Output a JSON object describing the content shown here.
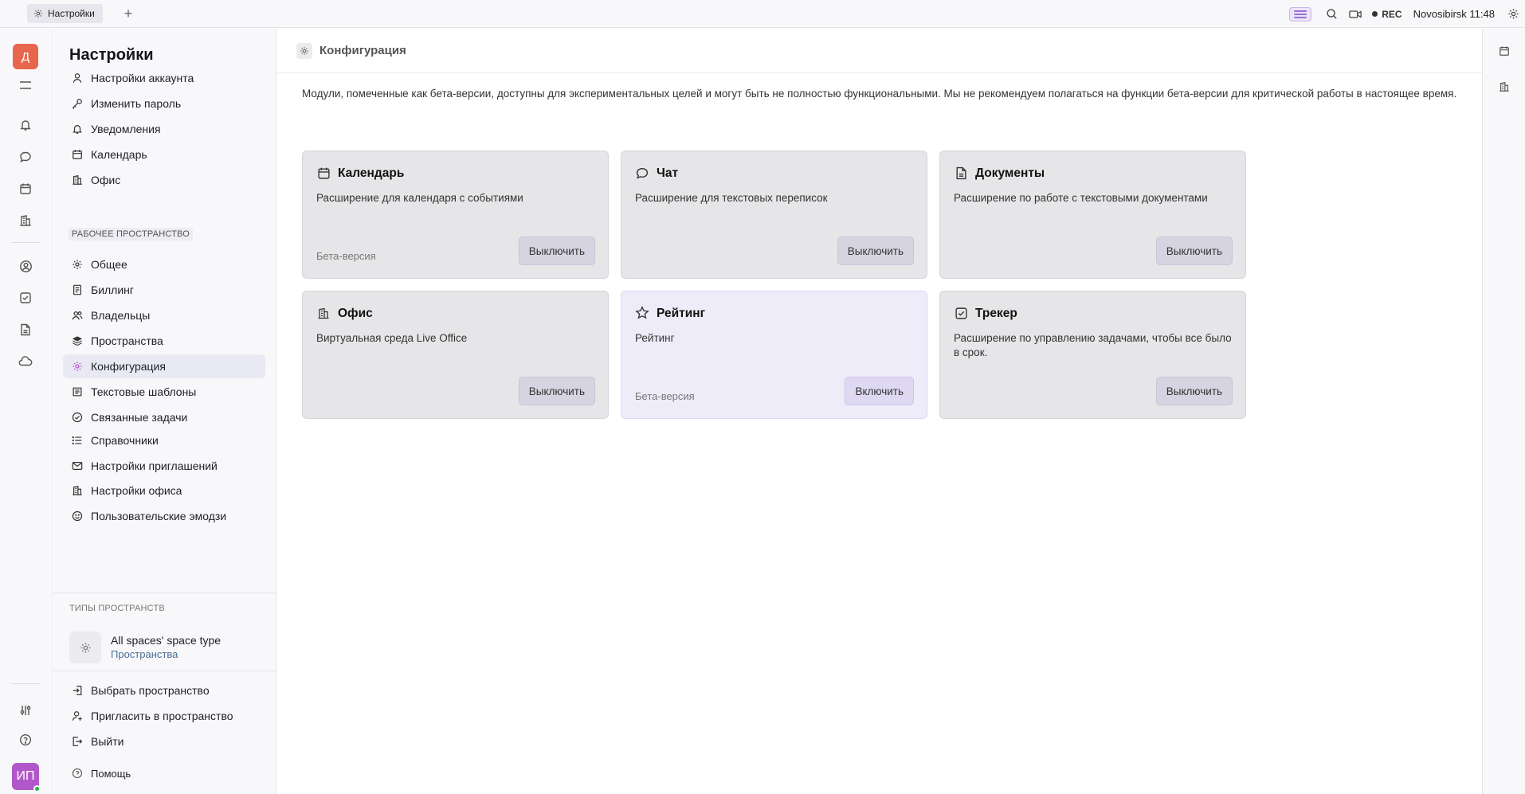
{
  "topbar": {
    "tab_label": "Настройки",
    "tab_icon": "gear-icon",
    "rec_label": "REC",
    "location": "Novosibirsk",
    "time": "11:48"
  },
  "rail": {
    "workspace_initial": "Д",
    "user_initials": "ИП"
  },
  "nav": {
    "title": "Настройки",
    "account_items": [
      {
        "label": "Настройки аккаунта",
        "icon": "user-icon"
      },
      {
        "label": "Изменить пароль",
        "icon": "key-icon"
      },
      {
        "label": "Уведомления",
        "icon": "bell-icon"
      },
      {
        "label": "Календарь",
        "icon": "calendar-icon"
      },
      {
        "label": "Офис",
        "icon": "building-icon"
      }
    ],
    "workspace_section": "РАБОЧЕЕ ПРОСТРАНСТВО",
    "workspace_items": [
      {
        "label": "Общее",
        "icon": "gear-icon"
      },
      {
        "label": "Биллинг",
        "icon": "receipt-icon"
      },
      {
        "label": "Владельцы",
        "icon": "people-icon"
      },
      {
        "label": "Пространства",
        "icon": "layers-icon"
      },
      {
        "label": "Конфигурация",
        "icon": "gear-icon",
        "active": true
      },
      {
        "label": "Текстовые шаблоны",
        "icon": "template-icon"
      },
      {
        "label": "Связанные задачи",
        "icon": "check-circle-icon"
      },
      {
        "label": "Справочники",
        "icon": "list-icon"
      },
      {
        "label": "Настройки приглашений",
        "icon": "mail-icon"
      },
      {
        "label": "Настройки офиса",
        "icon": "building-icon"
      },
      {
        "label": "Пользовательские эмодзи",
        "icon": "emoji-icon"
      }
    ],
    "space_types_section": "ТИПЫ ПРОСТРАНСТВ",
    "space_type": {
      "name": "All spaces' space type",
      "sub": "Пространства"
    },
    "bottom_items": [
      {
        "label": "Выбрать пространство",
        "icon": "enter-icon"
      },
      {
        "label": "Пригласить в пространство",
        "icon": "user-plus-icon"
      },
      {
        "label": "Выйти",
        "icon": "logout-icon"
      }
    ],
    "help_label": "Помощь"
  },
  "main": {
    "title": "Конфигурация",
    "notice": "Модули, помеченные как бета-версии, доступны для экспериментальных целей и могут быть не полностью функциональными. Мы не рекомендуем полагаться на функции бета-версии для критической работы в настоящее время.",
    "cards": [
      {
        "title": "Календарь",
        "desc": "Расширение для календаря с событиями",
        "beta": "Бета-версия",
        "button": "Выключить",
        "icon": "calendar-icon"
      },
      {
        "title": "Чат",
        "desc": "Расширение для текстовых переписок",
        "beta": "",
        "button": "Выключить",
        "icon": "chat-icon"
      },
      {
        "title": "Документы",
        "desc": "Расширение по работе с текстовыми документами",
        "beta": "",
        "button": "Выключить",
        "icon": "document-icon"
      },
      {
        "title": "Офис",
        "desc": "Виртуальная среда Live Office",
        "beta": "",
        "button": "Выключить",
        "icon": "building-icon"
      },
      {
        "title": "Рейтинг",
        "desc": "Рейтинг",
        "beta": "Бета-версия",
        "button": "Включить",
        "icon": "star-icon"
      },
      {
        "title": "Трекер",
        "desc": "Расширение по управлению задачами, чтобы все было в срок.",
        "beta": "",
        "button": "Выключить",
        "icon": "checkbox-icon"
      }
    ]
  },
  "colors": {
    "accent": "#b05cc6",
    "workspace_avatar": "#e8664c",
    "user_avatar": "#b257c9",
    "card_bg": "#e6e6e8",
    "card_beta_bg": "#efecfa"
  }
}
